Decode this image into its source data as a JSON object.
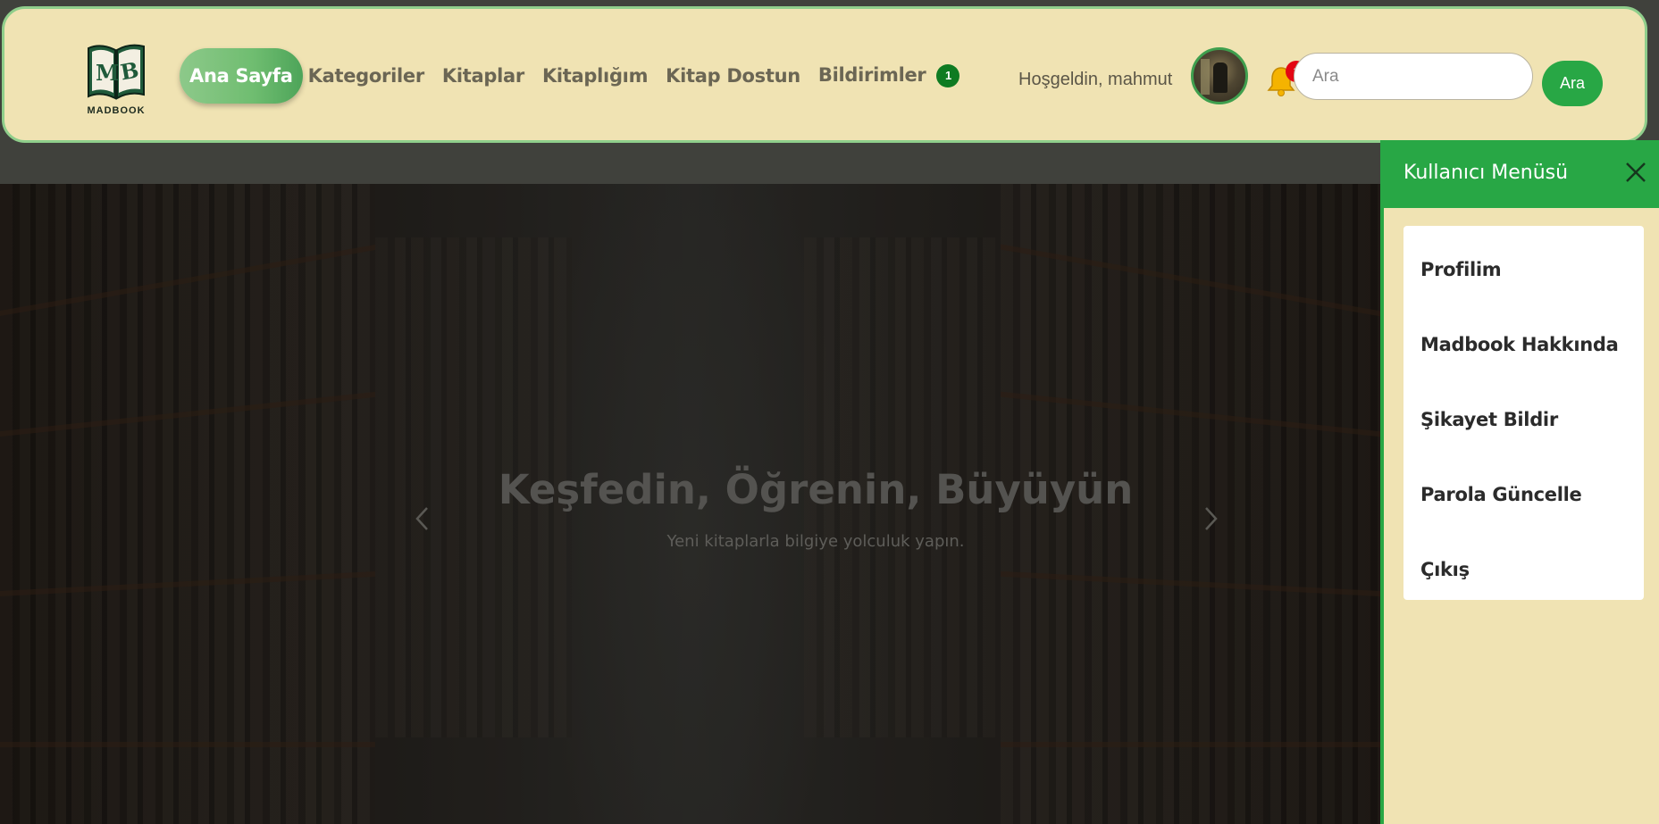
{
  "brand": {
    "logo_letters": "MB",
    "logo_text": "MADBOOK"
  },
  "nav": {
    "items": [
      {
        "label": "Ana Sayfa",
        "active": true
      },
      {
        "label": "Kategoriler",
        "active": false
      },
      {
        "label": "Kitaplar",
        "active": false
      },
      {
        "label": "Kitaplığım",
        "active": false
      },
      {
        "label": "Kitap Dostun",
        "active": false
      },
      {
        "label": "Bildirimler",
        "active": false
      }
    ],
    "notifications_count": "1"
  },
  "user": {
    "welcome": "Hoşgeldin, mahmut",
    "bell_badge": "1"
  },
  "search": {
    "placeholder": "Ara",
    "value": "",
    "button_label": "Ara"
  },
  "hero": {
    "title": "Keşfedin, Öğrenin, Büyüyün",
    "subtitle": "Yeni kitaplarla bilgiye yolculuk yapın.",
    "prev_icon": "chevron-left-icon",
    "next_icon": "chevron-right-icon"
  },
  "side_menu": {
    "title": "Kullanıcı Menüsü",
    "items": [
      {
        "label": "Profilim"
      },
      {
        "label": "Madbook Hakkında"
      },
      {
        "label": "Şikayet Bildir"
      },
      {
        "label": "Parola Güncelle"
      },
      {
        "label": "Çıkış"
      }
    ]
  },
  "colors": {
    "navbar_bg": "#f0e3b3",
    "navbar_border": "#8fce8b",
    "accent_green": "#28a745",
    "active_tab": "#6fbd70",
    "badge_red": "#e30613",
    "badge_green": "#0f7b22"
  }
}
